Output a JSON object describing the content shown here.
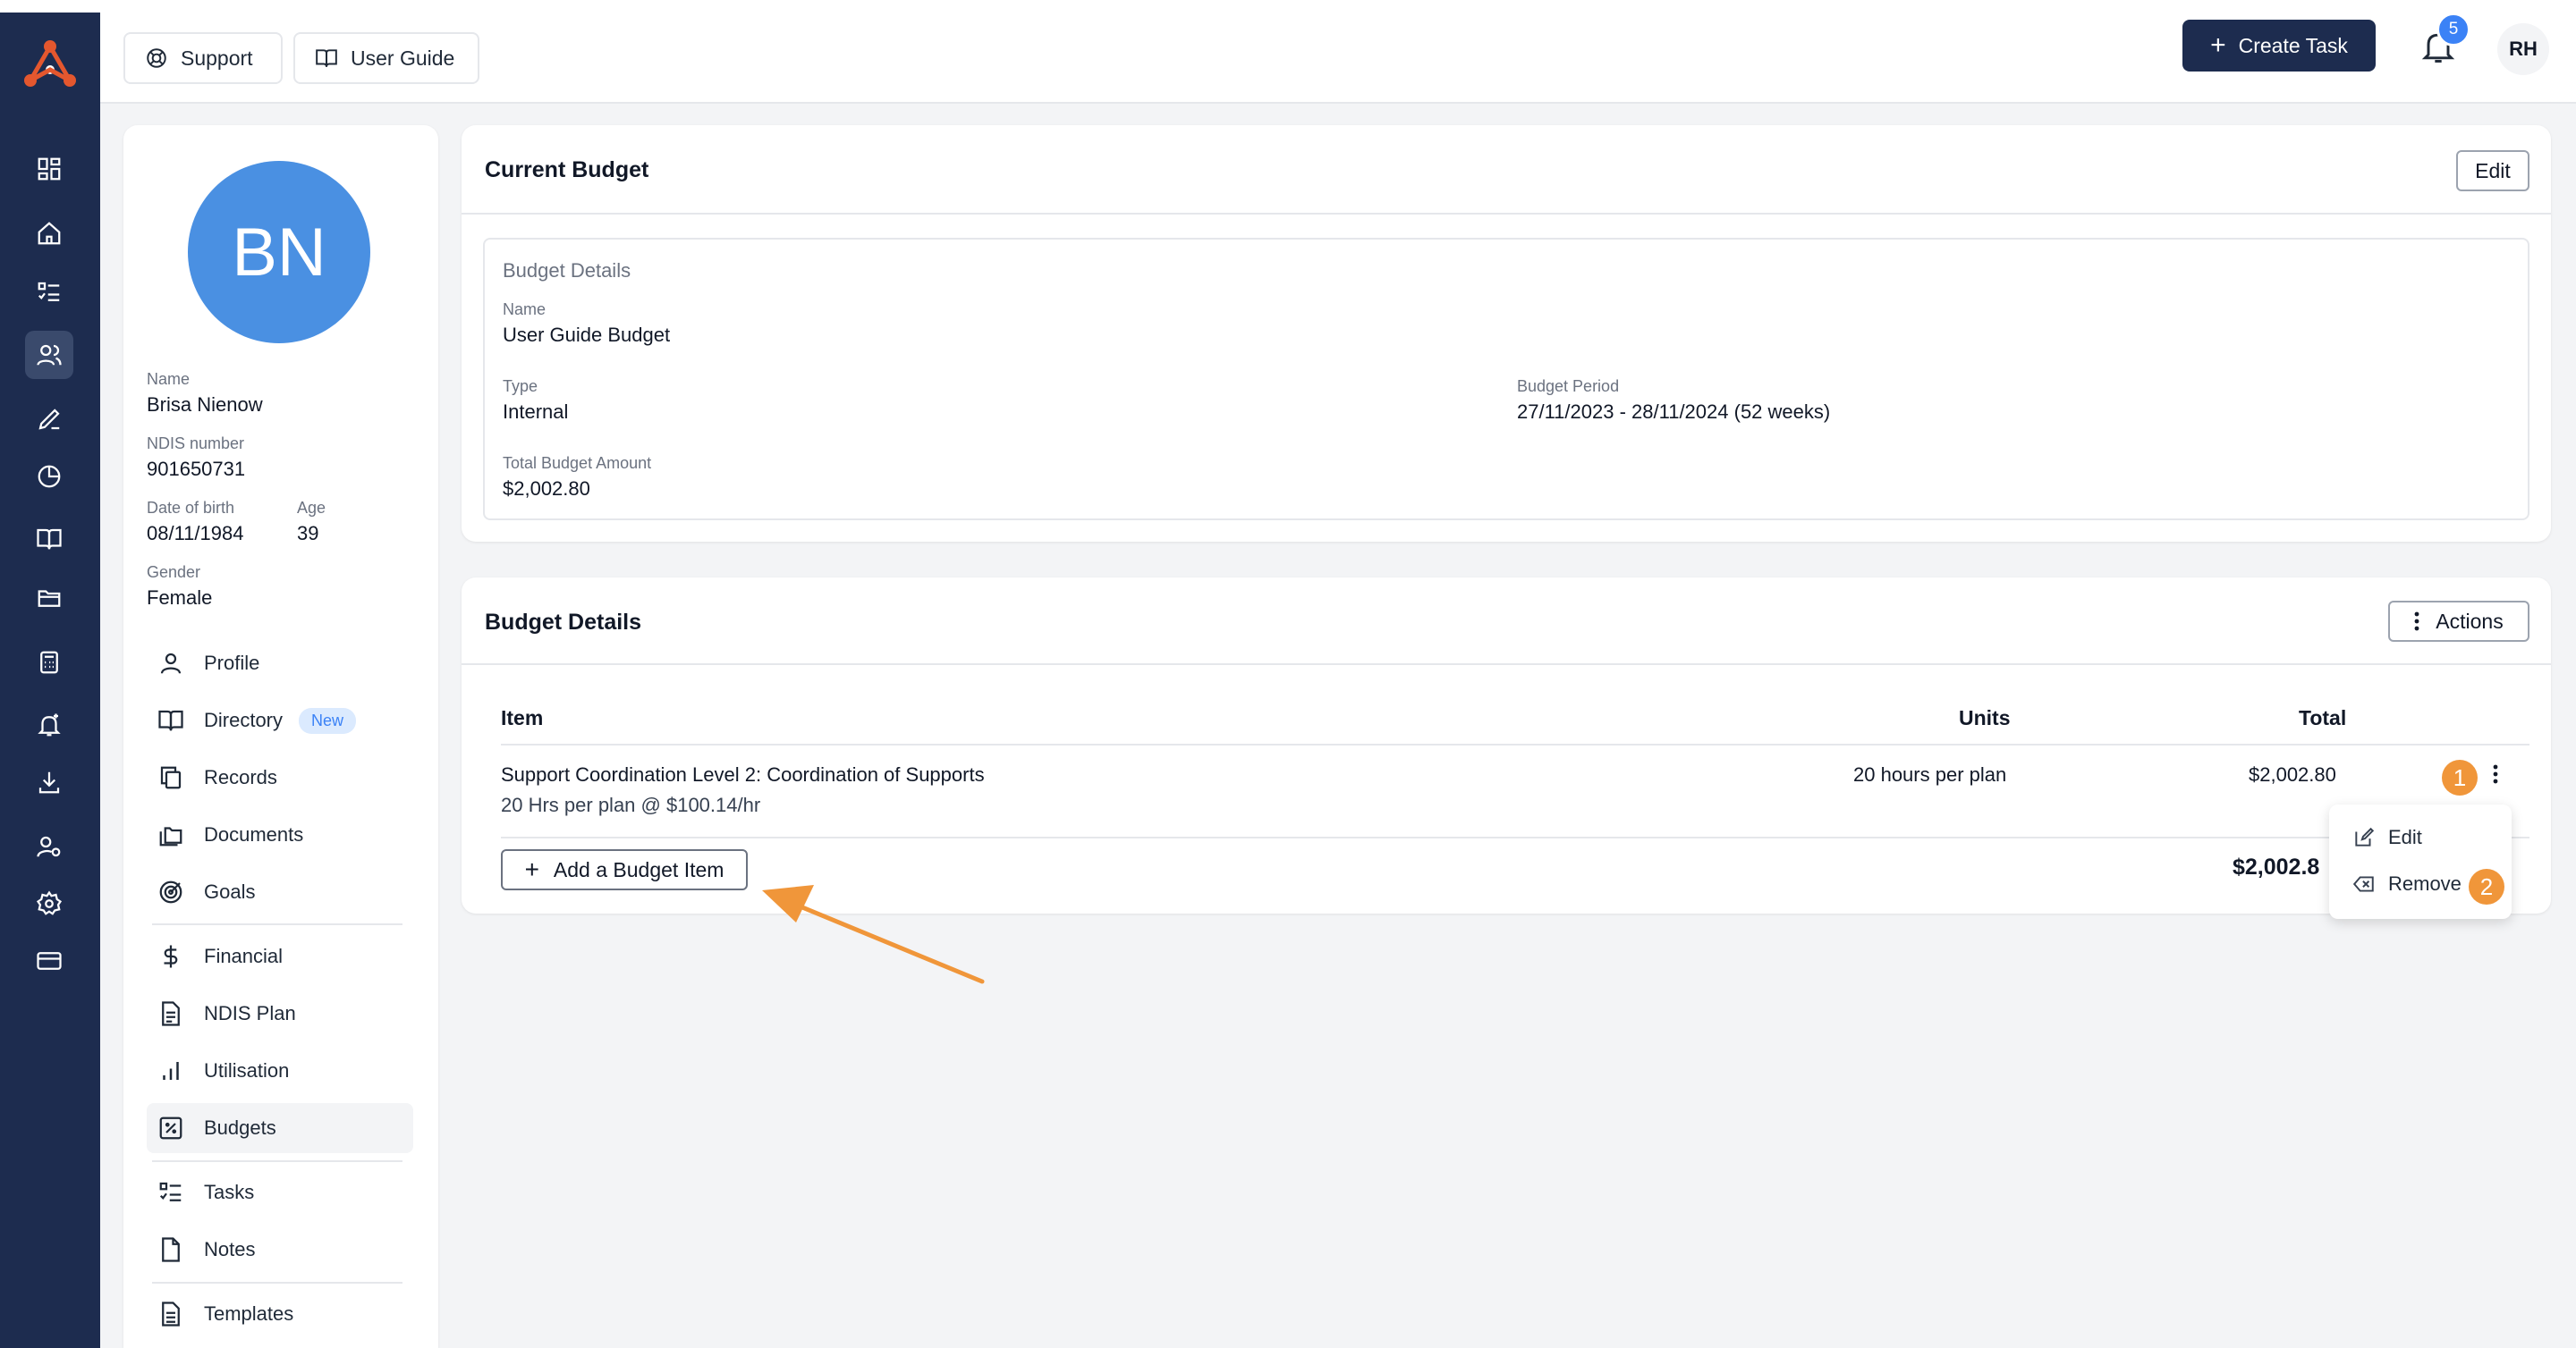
{
  "topbar": {
    "support_label": "Support",
    "guide_label": "User Guide",
    "create_task_label": "Create Task",
    "notification_count": "5",
    "user_initials": "RH"
  },
  "sidebar": {
    "icons": [
      "dashboard-icon",
      "home-icon",
      "list-icon",
      "people-icon",
      "signature-icon",
      "pie-chart-icon",
      "book-icon",
      "folder-icon",
      "calculator-icon",
      "bell-plus-icon",
      "download-icon",
      "user-settings-icon",
      "gear-icon",
      "card-icon"
    ],
    "active": "people-icon",
    "logo_color": "#e4572e"
  },
  "participant": {
    "initials": "BN",
    "name_label": "Name",
    "name": "Brisa Nienow",
    "ndis_label": "NDIS number",
    "ndis": "901650731",
    "dob_label": "Date of birth",
    "dob": "08/11/1984",
    "age_label": "Age",
    "age": "39",
    "gender_label": "Gender",
    "gender": "Female"
  },
  "menu": {
    "profile": "Profile",
    "directory": "Directory",
    "directory_badge": "New",
    "records": "Records",
    "documents": "Documents",
    "goals": "Goals",
    "financial": "Financial",
    "ndis_plan": "NDIS Plan",
    "utilisation": "Utilisation",
    "budgets": "Budgets",
    "tasks": "Tasks",
    "notes": "Notes",
    "templates": "Templates"
  },
  "current_budget": {
    "title": "Current Budget",
    "edit_label": "Edit",
    "section_label": "Budget Details",
    "name_label": "Name",
    "name": "User Guide Budget",
    "type_label": "Type",
    "type": "Internal",
    "period_label": "Budget Period",
    "period": "27/11/2023 - 28/11/2024 (52 weeks)",
    "total_label": "Total Budget Amount",
    "total": "$2,002.80"
  },
  "budget_details": {
    "title": "Budget Details",
    "actions_label": "Actions",
    "columns": {
      "item": "Item",
      "units": "Units",
      "total": "Total"
    },
    "rows": [
      {
        "item": "Support Coordination Level 2: Coordination of Supports",
        "sub": "20 Hrs per plan @ $100.14/hr",
        "units": "20 hours per plan",
        "total": "$2,002.80"
      }
    ],
    "add_label": "Add a Budget Item",
    "grand_total": "$2,002.8"
  },
  "row_menu": {
    "edit_label": "Edit",
    "remove_label": "Remove"
  },
  "annotations": {
    "step1": "1",
    "step2": "2",
    "color": "#f0963a"
  }
}
